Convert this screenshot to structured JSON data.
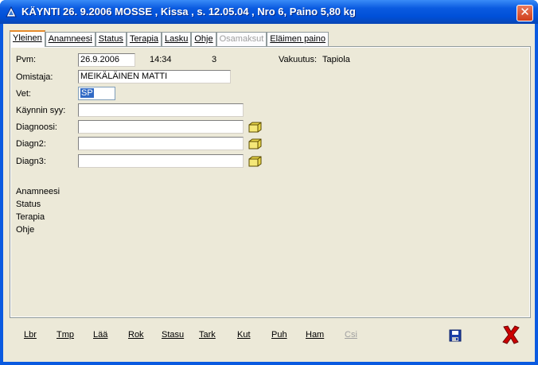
{
  "window": {
    "title": "KÄYNTI  26. 9.2006  MOSSE , Kissa , s. 12.05.04 , Nro 6, Paino   5,80 kg",
    "close_label": "✕"
  },
  "tabs": [
    {
      "label": "Yleinen",
      "active": true,
      "enabled": true
    },
    {
      "label": "Anamneesi",
      "active": false,
      "enabled": true
    },
    {
      "label": "Status",
      "active": false,
      "enabled": true
    },
    {
      "label": "Terapia",
      "active": false,
      "enabled": true
    },
    {
      "label": "Lasku",
      "active": false,
      "enabled": true
    },
    {
      "label": "Ohje",
      "active": false,
      "enabled": true
    },
    {
      "label": "Osamaksut",
      "active": false,
      "enabled": false
    },
    {
      "label": "Eläimen paino",
      "active": false,
      "enabled": true
    }
  ],
  "form": {
    "pvm_label": "Pvm:",
    "pvm_value": "26.9.2006",
    "time_value": "14:34",
    "number_value": "3",
    "vakuutus_label": "Vakuutus:",
    "vakuutus_value": "Tapiola",
    "omistaja_label": "Omistaja:",
    "omistaja_value": "MEIKÄLÄINEN MATTI",
    "vet_label": "Vet:",
    "vet_value": "SP",
    "syy_label": "Käynnin syy:",
    "syy_value": "",
    "diagnoosi_label": "Diagnoosi:",
    "diagnoosi_value": "",
    "diagn2_label": "Diagn2:",
    "diagn2_value": "",
    "diagn3_label": "Diagn3:",
    "diagn3_value": ""
  },
  "summary": [
    "Anamneesi",
    "Status",
    "Terapia",
    "Ohje"
  ],
  "bottom_buttons": [
    {
      "label": "Lbr",
      "enabled": true
    },
    {
      "label": "Tmp",
      "enabled": true
    },
    {
      "label": "Lää",
      "enabled": true
    },
    {
      "label": "Rok",
      "enabled": true
    },
    {
      "label": "Stasu",
      "enabled": true
    },
    {
      "label": "Tark",
      "enabled": true
    },
    {
      "label": "Kut",
      "enabled": true
    },
    {
      "label": "Puh",
      "enabled": true
    },
    {
      "label": "Ham",
      "enabled": true
    },
    {
      "label": "Csi",
      "enabled": false
    }
  ],
  "icons": {
    "folder": "folder-icon",
    "save": "save-icon",
    "exit": "exit-icon"
  },
  "colors": {
    "title_blue": "#0a5ae0",
    "panel_bg": "#ece9d8",
    "selection": "#316ac5",
    "exit_red": "#cc0000",
    "save_blue": "#1c3fa8",
    "tab_accent": "#e68b2c"
  }
}
